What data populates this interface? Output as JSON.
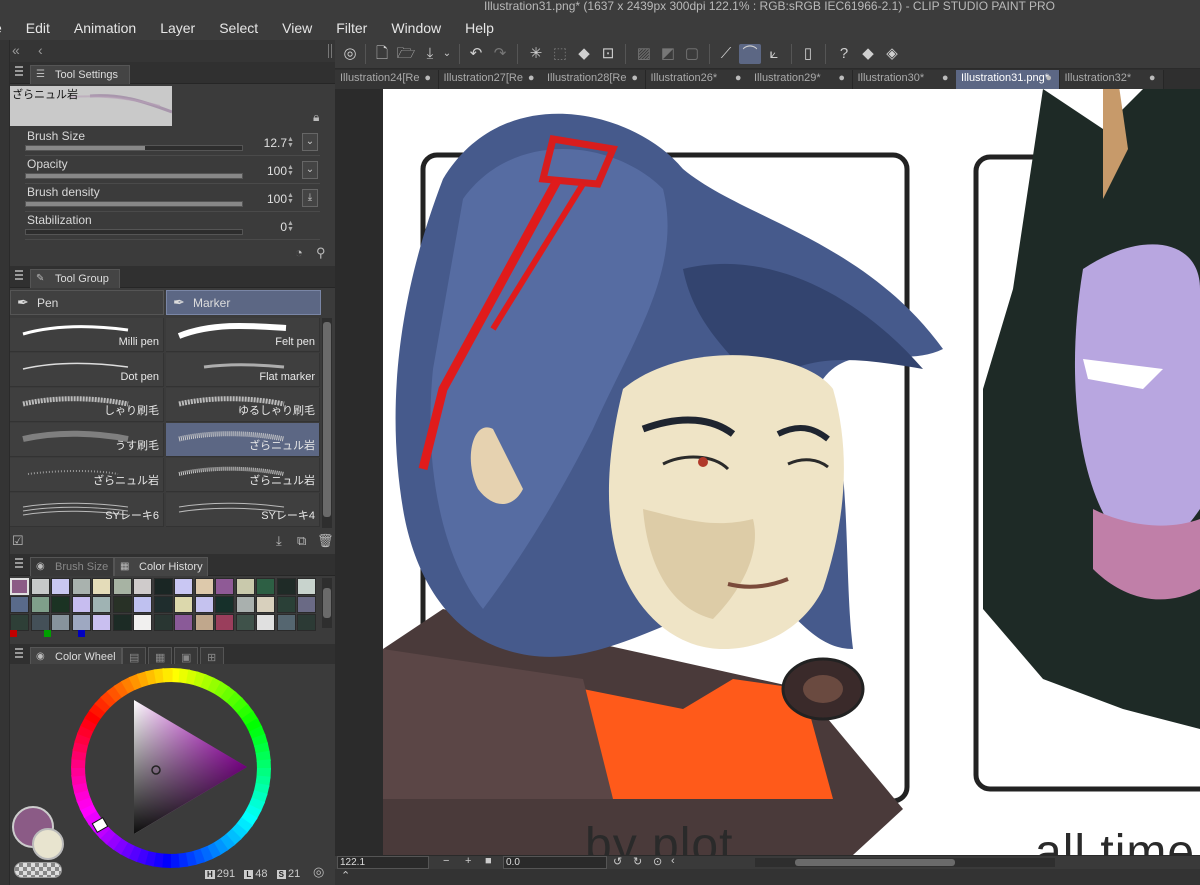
{
  "window": {
    "title": "Illustration31.png* (1637 x 2439px 300dpi 122.1% : RGB:sRGB IEC61966-2.1) - CLIP STUDIO PAINT PRO"
  },
  "menu": [
    "e",
    "Edit",
    "Animation",
    "Layer",
    "Select",
    "View",
    "Filter",
    "Window",
    "Help"
  ],
  "tool_settings": {
    "tab_label": "Tool Settings",
    "brush_name": "ざらニュル岩",
    "properties": [
      {
        "label": "Brush Size",
        "value": "12.7",
        "level": 0.55
      },
      {
        "label": "Opacity",
        "value": "100",
        "level": 1.0
      },
      {
        "label": "Brush density",
        "value": "100",
        "level": 1.0
      },
      {
        "label": "Stabilization",
        "value": "0",
        "level": 0.0
      }
    ]
  },
  "tool_group": {
    "tab_label": "Tool Group",
    "groups": [
      {
        "label": "Pen",
        "active": false
      },
      {
        "label": "Marker",
        "active": true
      }
    ],
    "brushes": [
      {
        "label": "Milli pen",
        "selected": false
      },
      {
        "label": "Felt pen",
        "selected": false
      },
      {
        "label": "Dot pen",
        "selected": false
      },
      {
        "label": "Flat marker",
        "selected": false
      },
      {
        "label": "しゃり刷毛",
        "selected": false
      },
      {
        "label": "ゆるしゃり刷毛",
        "selected": false
      },
      {
        "label": "うす刷毛",
        "selected": false
      },
      {
        "label": "ざらニュル岩",
        "selected": true
      },
      {
        "label": "ざらニュル岩",
        "selected": false
      },
      {
        "label": "ざらニュル岩",
        "selected": false
      },
      {
        "label": "SYレーキ6",
        "selected": false
      },
      {
        "label": "SYレーキ4",
        "selected": false
      }
    ]
  },
  "color_panel": {
    "tabs": [
      {
        "label": "Brush Size",
        "active": false
      },
      {
        "label": "Color History",
        "active": true
      }
    ],
    "swatches": [
      [
        "#8b5b86",
        "#c7c9c9",
        "#c9c8f0",
        "#a9b2ae",
        "#e4dcb9",
        "#a7b3a3",
        "#cfcbcb",
        "#1a2624",
        "#c9c7f3",
        "#ddc9ab",
        "#8f5a96",
        "#c9c9ac",
        "#2d5f44",
        "#1f2b27",
        "#c8d3cd"
      ],
      [
        "#596a8a",
        "#7f9f8a",
        "#1b3323",
        "#c7bdf0",
        "#9fb3b3",
        "#283126",
        "#bfc1f0",
        "#1f2d2d",
        "#dcd8ac",
        "#c5c2ef",
        "#16302a",
        "#a9b0ae",
        "#d8d0bd",
        "#2a4037",
        "#6a6a85"
      ],
      [
        "#2e3f37",
        "#445058",
        "#87939c",
        "#9ea8c1",
        "#c9bff0",
        "#1c2b25",
        "#f1f0ef",
        "#293632",
        "#8a5a98",
        "#c0a78c",
        "#9a3e5c",
        "#3f524a",
        "#e0e0e0",
        "#556670",
        "#2c3a35"
      ]
    ],
    "marks": [
      "#c00000",
      "#00a000",
      "#0000c0"
    ]
  },
  "color_wheel": {
    "tab_label": "Color Wheel",
    "main_color": "#8b5b86",
    "sub_color": "#e8e4cf",
    "hue_label": "H",
    "hue": "291",
    "lightness_label": "L",
    "lightness": "48",
    "saturation_label": "S",
    "saturation": "21"
  },
  "doc_tabs": [
    {
      "label": "Illustration24[Re",
      "active": false
    },
    {
      "label": "Illustration27[Re",
      "active": false
    },
    {
      "label": "Illustration28[Re",
      "active": false
    },
    {
      "label": "Illustration26*",
      "active": false
    },
    {
      "label": "Illustration29*",
      "active": false
    },
    {
      "label": "Illustration30*",
      "active": false
    },
    {
      "label": "Illustration31.png*",
      "active": true
    },
    {
      "label": "Illustration32*",
      "active": false
    }
  ],
  "canvas": {
    "caption_left": "by plot",
    "caption_right": "all time"
  },
  "status": {
    "zoom": "122.1",
    "angle": "0.0"
  },
  "colors": {
    "accent": "#5c6784",
    "panel": "#3b3b3b",
    "canvas_bg": "#2b2b2b"
  }
}
